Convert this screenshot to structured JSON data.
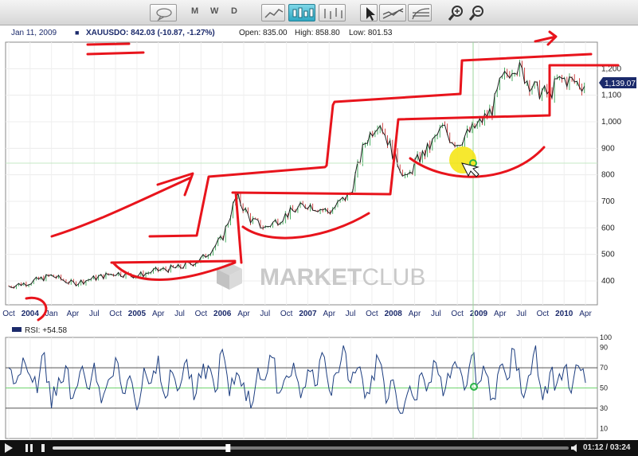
{
  "toolbar": {
    "m_label": "M",
    "w_label": "W",
    "d_label": "D"
  },
  "header": {
    "date": "Jan 11, 2009",
    "symbol_line": "XAUUSDO: 842.03 (-10.87, -1.27%)",
    "open_label": "Open: 835.00",
    "high_label": "High: 858.80",
    "low_label": "Low: 801.53",
    "watermark_bold": "MARKET",
    "watermark_light": "CLUB"
  },
  "colors": {
    "price_line": "#202020",
    "up_candle": "#1c9a3c",
    "down_candle": "#c41a1a",
    "rsi_line": "#1d3e80",
    "annotation": "#e8141c",
    "highlight": "#f5e40a",
    "cursor_marker": "#2bb34a",
    "price_badge": "#1b2a6b"
  },
  "chart_data": [
    {
      "type": "line",
      "title": "XAUUSDO",
      "y_ticks": [
        400,
        500,
        600,
        700,
        800,
        900,
        1000,
        1100,
        1200
      ],
      "y_tick_labels": [
        "400",
        "500",
        "600",
        "700",
        "800",
        "900",
        "1,000",
        "1,100",
        "1,200"
      ],
      "ylim": [
        310,
        1300
      ],
      "x_tick_labels": [
        "Oct",
        "2004",
        "Jan",
        "Apr",
        "Jul",
        "Oct",
        "2005",
        "Apr",
        "Jul",
        "Oct",
        "2006",
        "Apr",
        "Jul",
        "Oct",
        "2007",
        "Apr",
        "Jul",
        "Oct",
        "2008",
        "Apr",
        "Jul",
        "Oct",
        "2009",
        "Apr",
        "Jul",
        "Oct",
        "2010",
        "Apr"
      ],
      "last_price_label": "1,139.07",
      "cursor_date": "Jan 11, 2009",
      "x_months": [
        0,
        3,
        6,
        9,
        12,
        15,
        18,
        21,
        24,
        27,
        30,
        32,
        34,
        36,
        39,
        42,
        45,
        48,
        50,
        52,
        54,
        56,
        57,
        59,
        61,
        62,
        63,
        66,
        68,
        69,
        71,
        74,
        76,
        77,
        78,
        81
      ],
      "values": [
        380,
        395,
        420,
        390,
        410,
        430,
        420,
        440,
        450,
        480,
        560,
        720,
        630,
        600,
        650,
        690,
        660,
        730,
        920,
        1010,
        880,
        780,
        842,
        900,
        980,
        940,
        920,
        990,
        1050,
        1140,
        1220,
        1120,
        1100,
        1150,
        1160,
        1139
      ]
    },
    {
      "type": "line",
      "title": "RSI: +54.58",
      "y_ticks": [
        10,
        30,
        50,
        70,
        90,
        100
      ],
      "y_tick_labels": [
        "10",
        "30",
        "50",
        "70",
        "90",
        "100"
      ],
      "ylim": [
        0,
        100
      ],
      "reference_lines": [
        30,
        50,
        70
      ],
      "x_months": [
        0,
        1,
        2,
        3,
        4,
        5,
        6,
        7,
        8,
        9,
        10,
        11,
        12,
        13,
        14,
        15,
        16,
        17,
        18,
        19,
        20,
        21,
        22,
        23,
        24,
        25,
        26,
        27,
        28,
        29,
        30,
        31,
        32,
        33,
        34,
        35,
        36,
        37,
        38,
        39,
        40,
        41,
        42,
        43,
        44,
        45,
        46,
        47,
        48,
        49,
        50,
        51,
        52,
        53,
        54,
        55,
        56,
        57,
        58,
        59,
        60,
        61,
        62,
        63,
        64,
        65,
        66,
        67,
        68,
        69,
        70,
        71,
        72,
        73,
        74,
        75,
        76,
        77,
        78,
        79,
        80,
        81
      ],
      "values": [
        70,
        55,
        80,
        62,
        45,
        85,
        30,
        60,
        72,
        40,
        66,
        50,
        75,
        35,
        58,
        80,
        45,
        62,
        28,
        70,
        55,
        82,
        40,
        65,
        50,
        78,
        38,
        60,
        72,
        46,
        88,
        42,
        65,
        55,
        30,
        70,
        58,
        80,
        45,
        62,
        75,
        40,
        68,
        52,
        85,
        48,
        65,
        92,
        55,
        70,
        40,
        62,
        78,
        35,
        58,
        25,
        45,
        38,
        65,
        55,
        75,
        42,
        60,
        70,
        48,
        82,
        55,
        65,
        40,
        72,
        58,
        88,
        45,
        62,
        92,
        38,
        65,
        55,
        70,
        45,
        72,
        55
      ]
    }
  ],
  "player": {
    "time_label": "01:12 / 03:24",
    "progress": 0.34
  }
}
